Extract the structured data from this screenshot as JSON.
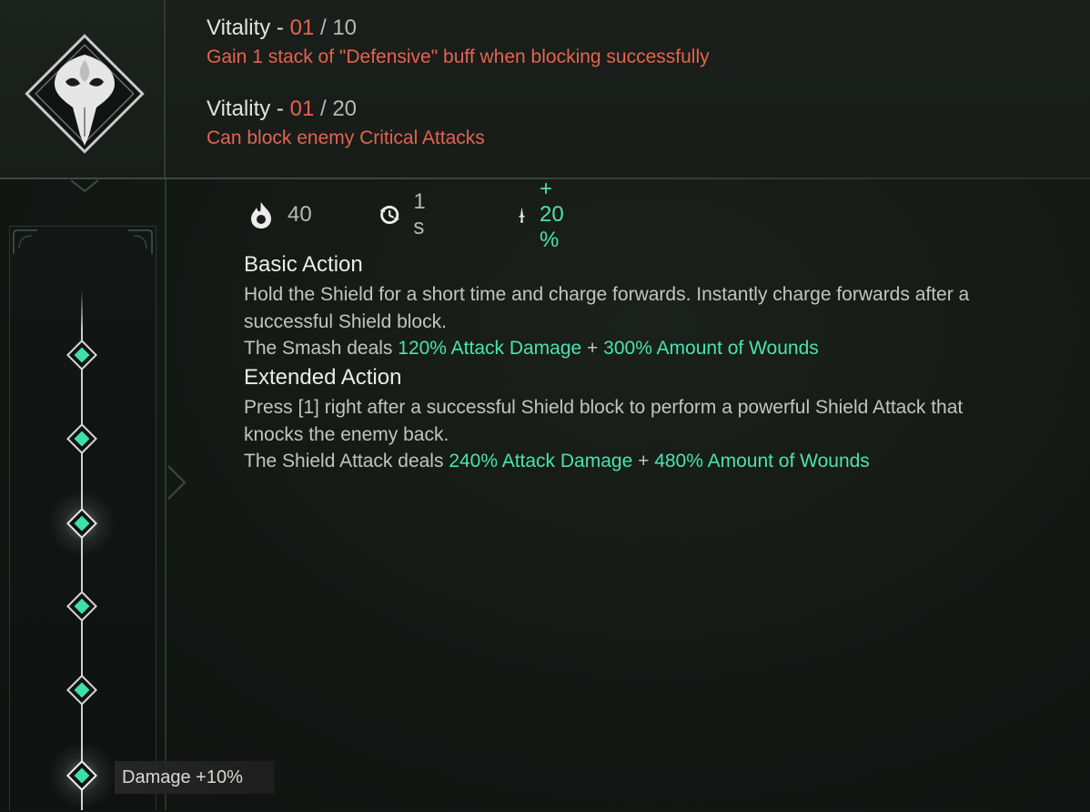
{
  "vitality_1": {
    "label": "Vitality - ",
    "current": "01",
    "sep": " / ",
    "max": "10",
    "desc": "Gain 1 stack of \"Defensive\" buff when blocking successfully"
  },
  "vitality_2": {
    "label": "Vitality - ",
    "current": "01",
    "sep": " / ",
    "max": "20",
    "desc": "Can block enemy Critical Attacks"
  },
  "stats": {
    "cost": "40",
    "cooldown": "1 s",
    "bonus": "+ 20 %"
  },
  "basic": {
    "title": "Basic Action",
    "line1": "Hold the Shield for a short time and charge forwards. Instantly charge forwards after a successful Shield block.",
    "line2_prefix": "The Smash deals ",
    "line2_hl1": "120% Attack Damage",
    "line2_plus": " + ",
    "line2_hl2": "300% Amount of Wounds"
  },
  "extended": {
    "title": "Extended Action",
    "line1": "Press [1] right after a successful Shield block to perform a powerful Shield Attack that knocks the enemy back.",
    "line2_prefix": "The Shield Attack deals ",
    "line2_hl1": "240% Attack Damage",
    "line2_plus": " + ",
    "line2_hl2": "480% Amount of Wounds"
  },
  "tooltip": {
    "text": "Damage +10%"
  },
  "icons": {
    "skill": "shield-mask-emblem-icon",
    "cost": "flame-drop-icon",
    "cooldown": "clock-arrow-icon",
    "bonus": "dagger-icon",
    "node": "diamond-node-icon"
  },
  "colors": {
    "accent_green": "#49e3b0",
    "accent_red": "#e5634f",
    "node": "#3ee0a8"
  }
}
